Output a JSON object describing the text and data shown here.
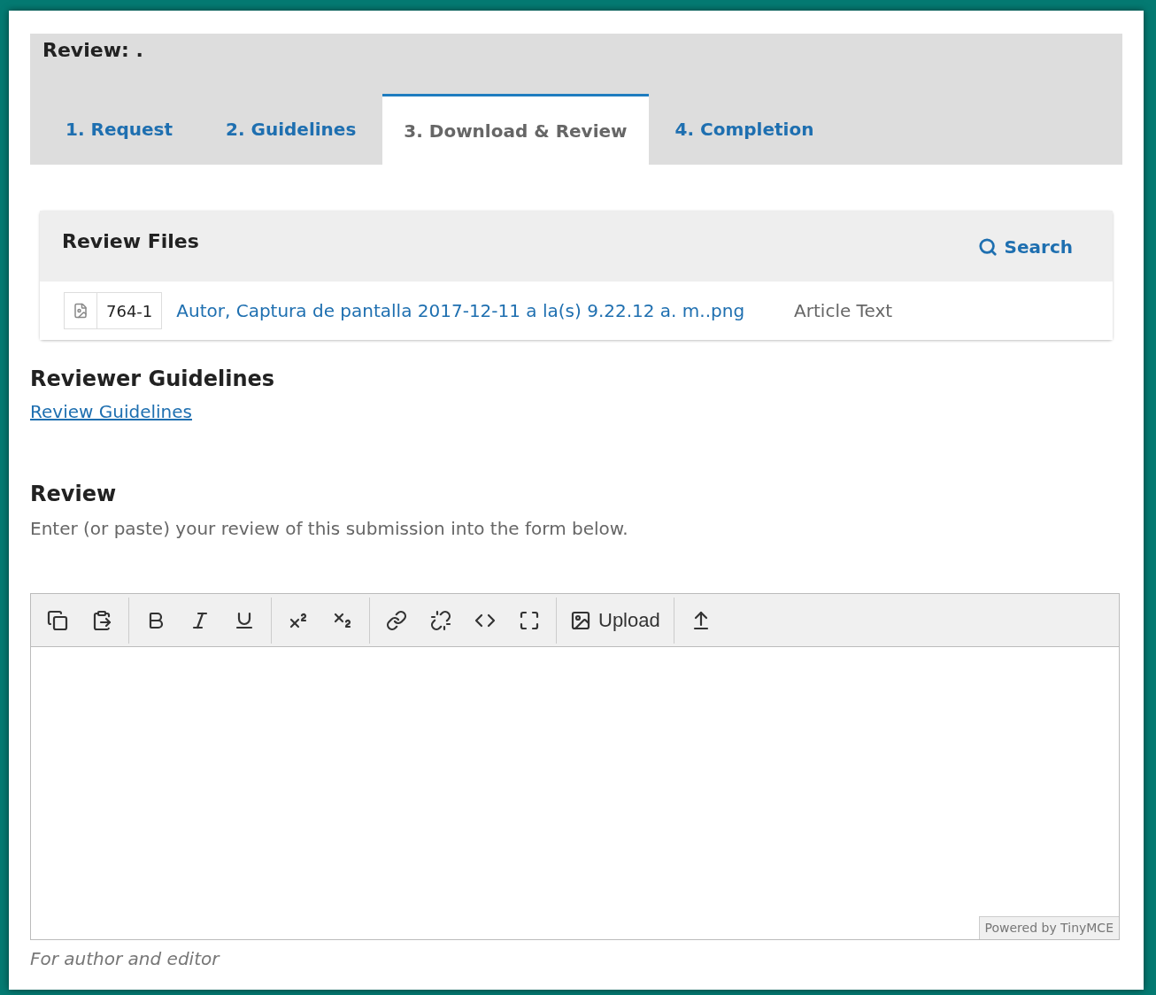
{
  "header": {
    "title": "Review: ."
  },
  "tabs": [
    {
      "label": "1. Request",
      "selected": false
    },
    {
      "label": "2. Guidelines",
      "selected": false
    },
    {
      "label": "3. Download & Review",
      "selected": true
    },
    {
      "label": "4. Completion",
      "selected": false
    }
  ],
  "review_files": {
    "title": "Review Files",
    "search": "Search",
    "files": [
      {
        "id": "764-1",
        "name": "Autor, Captura de pantalla 2017-12-11 a la(s) 9.22.12 a. m..png",
        "type": "Article Text"
      }
    ]
  },
  "guidelines": {
    "title": "Reviewer Guidelines",
    "link": "Review Guidelines"
  },
  "review": {
    "title": "Review",
    "description": "Enter (or paste) your review of this submission into the form below."
  },
  "editor": {
    "toolbar": [
      [
        {
          "kind": "copy"
        },
        {
          "kind": "paste"
        }
      ],
      [
        {
          "kind": "bold"
        },
        {
          "kind": "italic"
        },
        {
          "kind": "underline"
        }
      ],
      [
        {
          "kind": "superscript"
        },
        {
          "kind": "subscript"
        }
      ],
      [
        {
          "kind": "link"
        },
        {
          "kind": "unlink"
        },
        {
          "kind": "code"
        },
        {
          "kind": "fullscreen"
        }
      ],
      [
        {
          "kind": "image",
          "label": "Upload"
        }
      ],
      [
        {
          "kind": "insert"
        }
      ]
    ],
    "branding": "Powered by TinyMCE",
    "note": "For author and editor"
  }
}
